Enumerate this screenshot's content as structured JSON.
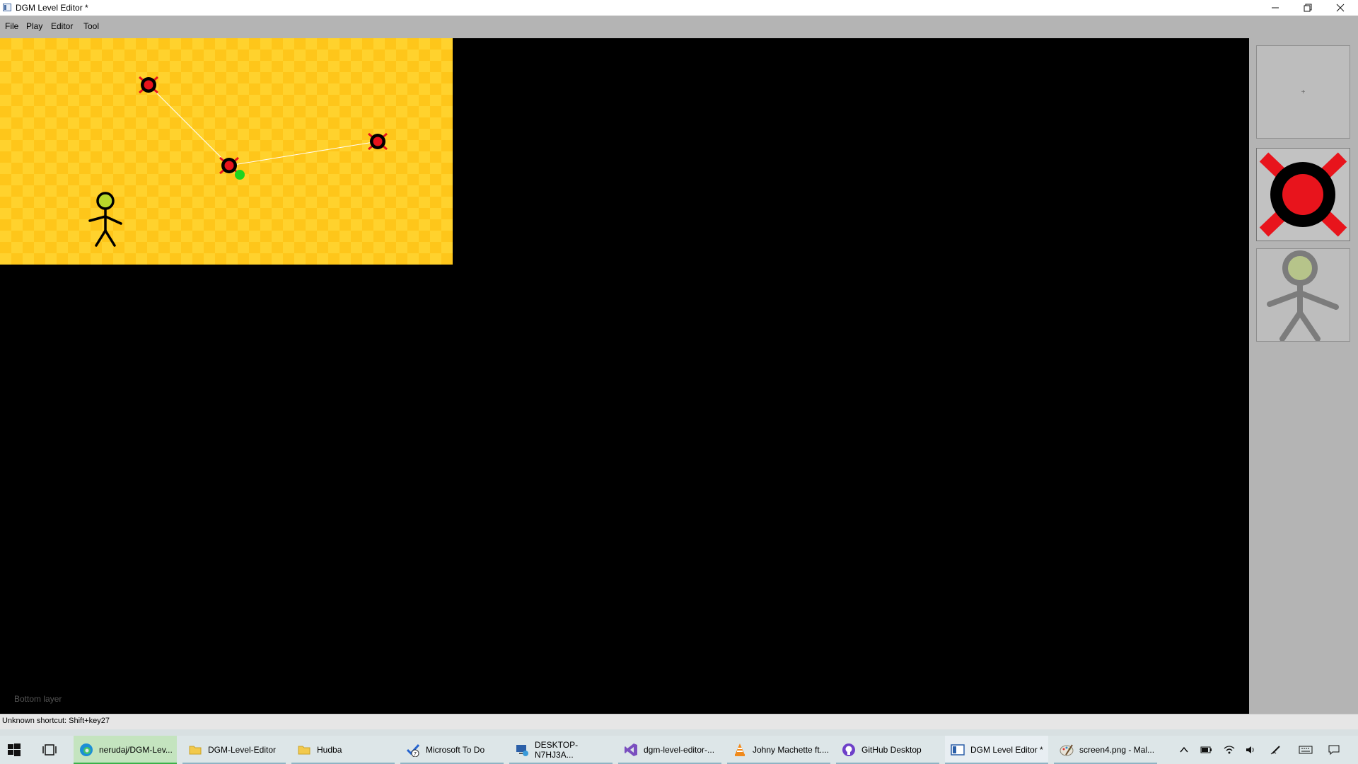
{
  "window": {
    "title": "DGM Level Editor *",
    "minimize_glyph": "—",
    "restore_glyph": "❐",
    "close_glyph": "✕"
  },
  "menu": {
    "items": [
      "File",
      "Play",
      "Editor",
      "Tool"
    ]
  },
  "editor": {
    "layer_label": "Bottom layer",
    "background_color": "#000000",
    "level_color": "#fec61a"
  },
  "palette": {
    "add_glyph": "+",
    "tiles": [
      {
        "icon": "add-tile-icon"
      },
      {
        "icon": "spike-mine-icon"
      },
      {
        "icon": "stickman-player-icon"
      }
    ]
  },
  "status": {
    "message": "Unknown shortcut: Shift+key27"
  },
  "taskbar": {
    "items": [
      {
        "label": "nerudaj/DGM-Lev...",
        "icon": "edge-browser-icon"
      },
      {
        "label": "DGM-Level-Editor",
        "icon": "folder-icon"
      },
      {
        "label": "Hudba",
        "icon": "folder-icon"
      },
      {
        "label": "Microsoft To Do",
        "icon": "todo-icon",
        "badge": "7"
      },
      {
        "label": "DESKTOP-N7HJ3A...",
        "icon": "remote-desktop-icon"
      },
      {
        "label": "dgm-level-editor-...",
        "icon": "visual-studio-icon"
      },
      {
        "label": "Johny Machette ft....",
        "icon": "vlc-icon"
      },
      {
        "label": "GitHub Desktop",
        "icon": "github-icon"
      },
      {
        "label": "DGM Level Editor *",
        "icon": "app-window-icon"
      },
      {
        "label": "screen4.png - Mal...",
        "icon": "paint-icon"
      }
    ],
    "tray": [
      "chevron-up-icon",
      "battery-icon",
      "wifi-icon",
      "volume-icon",
      "pen-icon",
      "keyboard-icon",
      "notification-icon"
    ]
  }
}
